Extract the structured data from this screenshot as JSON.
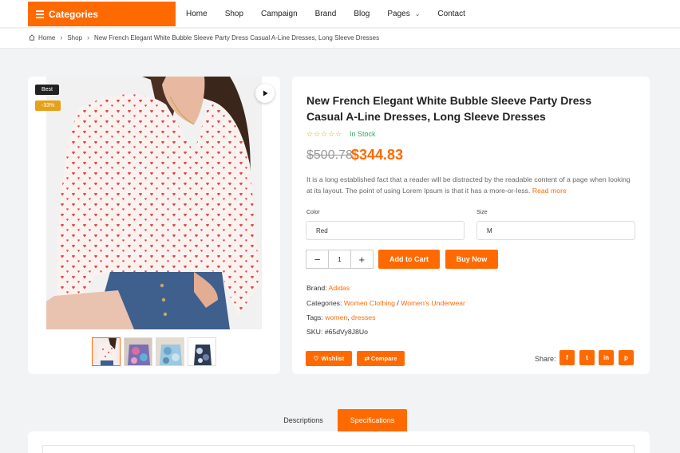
{
  "nav": {
    "categories_label": "Categories",
    "menu": [
      {
        "label": "Home"
      },
      {
        "label": "Shop"
      },
      {
        "label": "Campaign"
      },
      {
        "label": "Brand"
      },
      {
        "label": "Blog"
      },
      {
        "label": "Pages",
        "has_dropdown": true
      },
      {
        "label": "Contact"
      }
    ]
  },
  "breadcrumb": [
    "Home",
    "Shop",
    "New French Elegant White Bubble Sleeve Party Dress Casual A-Line Dresses, Long Sleeve Dresses"
  ],
  "gallery": {
    "badge_best": "Best",
    "badge_discount": "-33%",
    "play_icon": "play-icon",
    "thumbnails": [
      {
        "name": "white-heart-blouse",
        "active": true
      },
      {
        "name": "tie-dye-top",
        "active": false
      },
      {
        "name": "blue-tie-dye-top",
        "active": false
      },
      {
        "name": "camo-tie-dye-top",
        "active": false
      }
    ]
  },
  "product": {
    "title": "New French Elegant White Bubble Sleeve Party Dress Casual A-Line Dresses, Long Sleeve Dresses",
    "stars": "☆☆☆☆☆",
    "rating": 0,
    "stock": "In Stock",
    "old_price": "$500.78",
    "price": "$344.83",
    "description": "It is a long established fact that a reader will be distracted by the readable content of a page when looking at its layout. The point of using Lorem Ipsum is that it has a more-or-less.",
    "read_more": "Read more",
    "color_label": "Color",
    "color_value": "Red",
    "size_label": "Size",
    "size_value": "M",
    "quantity": "1",
    "add_to_cart": "Add to Cart",
    "buy_now": "Buy Now",
    "brand_label": "Brand:",
    "brand": "Adidas",
    "categories_label": "Categories:",
    "category_1": "Women Clothing",
    "category_sep": "/",
    "category_2": "Women's Underwear",
    "tags_label": "Tags:",
    "tag_1": "women",
    "tag_sep": ",",
    "tag_2": "dresses",
    "sku_label": "SKU:",
    "sku": "#65dVy8J8Uo",
    "wishlist": "Wishlist",
    "compare": "Compare",
    "share_label": "Share:",
    "social": [
      {
        "name": "facebook-icon",
        "glyph": "f"
      },
      {
        "name": "twitter-icon",
        "glyph": "t"
      },
      {
        "name": "linkedin-icon",
        "glyph": "in"
      },
      {
        "name": "pinterest-icon",
        "glyph": "p"
      }
    ]
  },
  "tabs": [
    {
      "label": "Descriptions",
      "active": false
    },
    {
      "label": "Specifications",
      "active": true
    }
  ],
  "colors": {
    "accent": "#ff6a00",
    "stock_green": "#3aa86b",
    "badge_dark": "#222222",
    "badge_discount": "#e6a11a"
  }
}
